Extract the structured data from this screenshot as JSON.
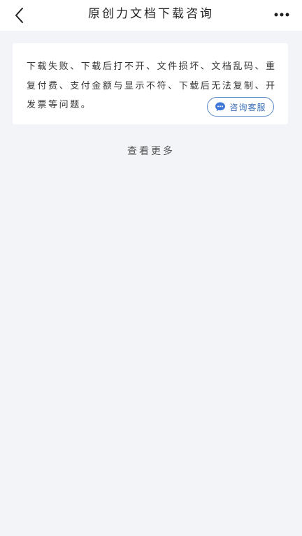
{
  "header": {
    "title": "原创力文档下载咨询",
    "back_icon": "chevron-left-icon",
    "more_icon": "more-dots-icon"
  },
  "notice": {
    "text": "下载失败、下载后打不开、文件损坏、文档乱码、重复付费、支付金额与显示不符、下载后无法复制、开发票等问题。",
    "button_label": "咨询客服",
    "button_icon": "chat-bubble-icon"
  },
  "footer": {
    "view_more": "查看更多"
  },
  "colors": {
    "page_background": "#f2f4f8",
    "card_background": "#ffffff",
    "accent": "#3a6fb8"
  }
}
